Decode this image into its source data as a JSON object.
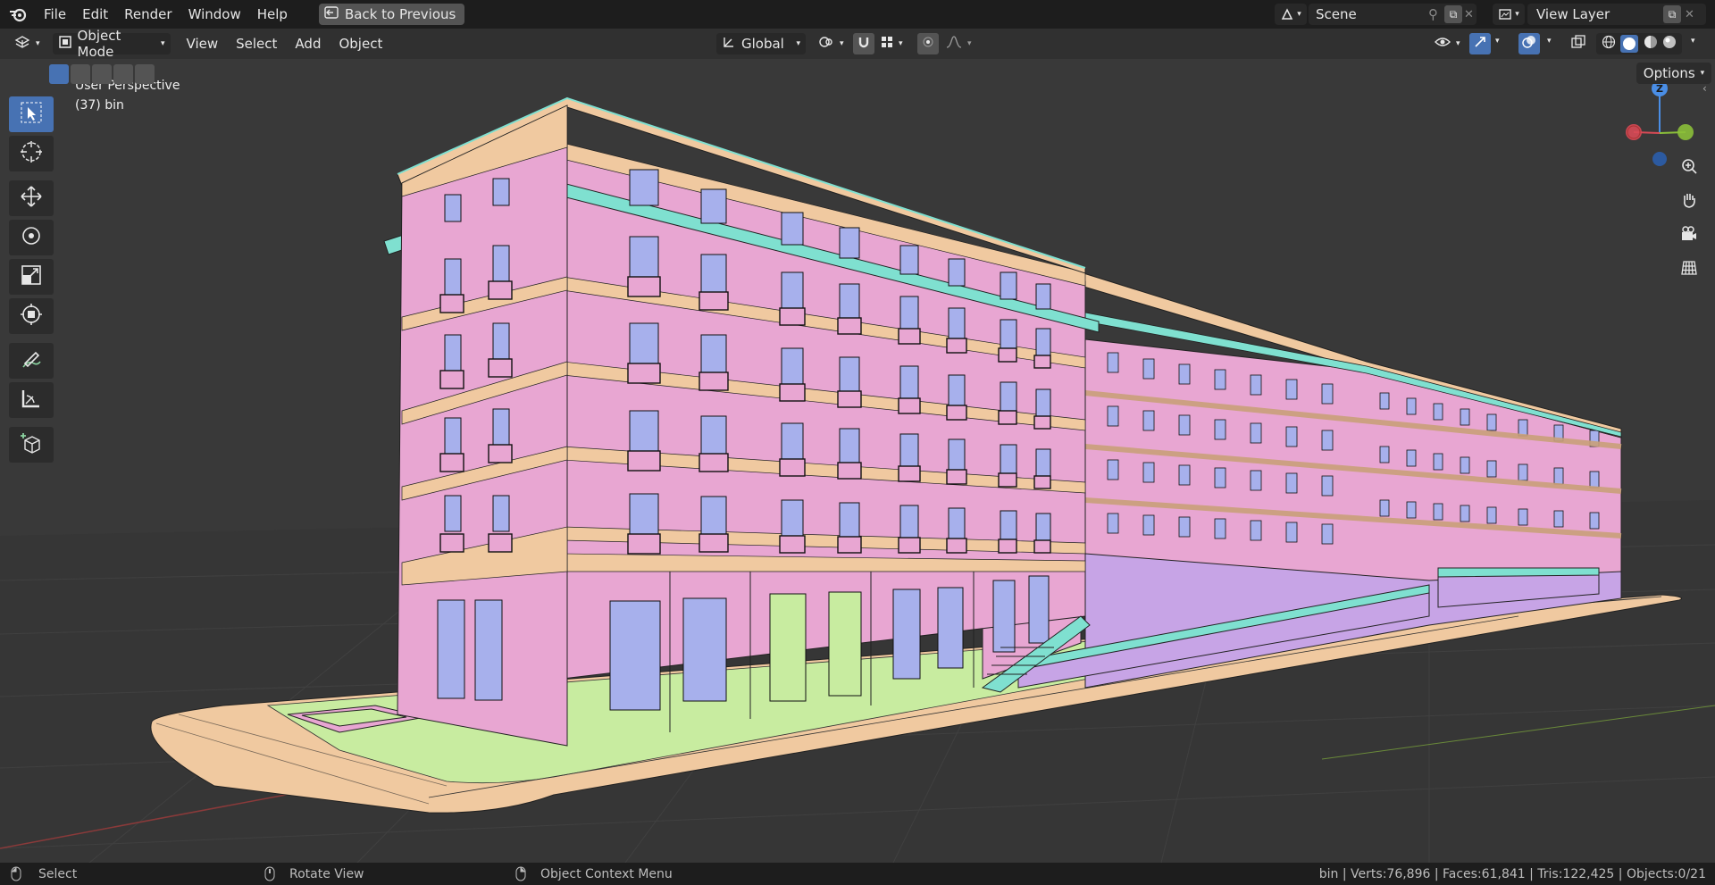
{
  "menu": {
    "file": "File",
    "edit": "Edit",
    "render": "Render",
    "window": "Window",
    "help": "Help",
    "back": "Back to Previous"
  },
  "scene": {
    "name": "Scene",
    "view_layer": "View Layer"
  },
  "header": {
    "mode": "Object Mode",
    "view": "View",
    "select": "Select",
    "add": "Add",
    "object": "Object",
    "transform": "Global",
    "options": "Options"
  },
  "overlay": {
    "perspective": "User Perspective",
    "object": "(37) bin"
  },
  "gizmo": {
    "z": "Z"
  },
  "status": {
    "select": "Select",
    "rotate": "Rotate View",
    "context": "Object Context Menu",
    "stats": "bin | Verts:76,896 | Faces:61,841 | Tris:122,425 | Objects:0/21"
  },
  "colors": {
    "pink": "#e8a6d2",
    "beige": "#f0c9a0",
    "cyan": "#7fe0d0",
    "lilac": "#c7a4e6",
    "green": "#c8eca0",
    "window": "#a7b0ec",
    "accent": "#4772b3"
  }
}
